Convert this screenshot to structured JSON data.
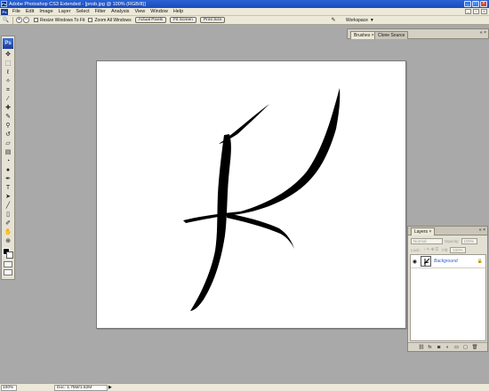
{
  "titlebar": {
    "title": "Adobe Photoshop CS3 Extended - [pnsb.jpg @ 100% (RGB/8)]",
    "app_icon": "Ps"
  },
  "menubar": {
    "logo": "Ps",
    "items": [
      "File",
      "Edit",
      "Image",
      "Layer",
      "Select",
      "Filter",
      "Analysis",
      "View",
      "Window",
      "Help"
    ]
  },
  "options": {
    "resize_label": "Resize Windows To Fit",
    "zoom_all_label": "Zoom All Windows",
    "actual_pixels": "Actual Pixels",
    "fit_screen": "Fit Screen",
    "print_size": "Print Size",
    "workspace": "Workspace"
  },
  "toolbox": {
    "logo": "Ps"
  },
  "brushes_panel": {
    "tabs": [
      "Brushes ×",
      "Clone Source"
    ]
  },
  "layers_panel": {
    "tab": "Layers ×",
    "blend_mode": "Normal",
    "opacity_label": "Opacity:",
    "opacity_value": "100%",
    "lock_label": "Lock:",
    "fill_label": "Fill:",
    "fill_value": "100%",
    "layer_name": "Background"
  },
  "statusbar": {
    "zoom": "100%",
    "doc": "Doc: 1.75M/1.62M"
  },
  "colors": {
    "titlebar": "#1b4bb8",
    "workspace_bg": "#a9a9a9",
    "chrome": "#ece9d8",
    "layer_name_color": "#2a5fc8"
  }
}
